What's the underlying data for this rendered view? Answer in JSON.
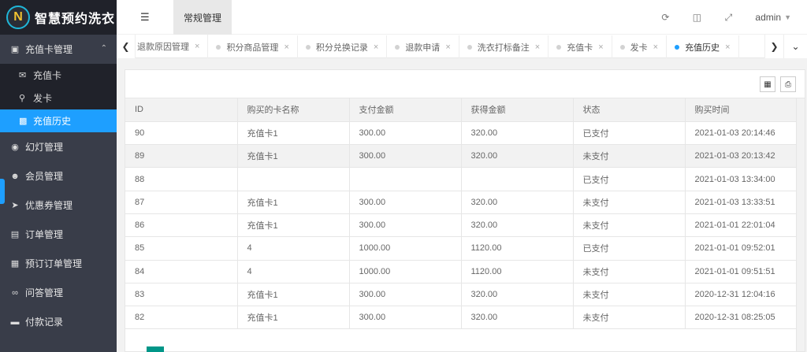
{
  "app": {
    "title": "智慧预约洗衣",
    "logo_letter": "N"
  },
  "sidebar": {
    "groups": [
      {
        "label": "充值卡管理",
        "icon": "gift-icon",
        "expanded": true,
        "items": [
          {
            "label": "充值卡",
            "icon": "envelope-icon"
          },
          {
            "label": "发卡",
            "icon": "tag-icon"
          },
          {
            "label": "充值历史",
            "icon": "briefcase-icon",
            "active": true
          }
        ]
      },
      {
        "label": "幻灯管理",
        "icon": "slides-icon"
      },
      {
        "label": "会员管理",
        "icon": "users-icon"
      },
      {
        "label": "优惠券管理",
        "icon": "rocket-icon"
      },
      {
        "label": "订单管理",
        "icon": "cart-icon"
      },
      {
        "label": "预订订单管理",
        "icon": "calendar-icon"
      },
      {
        "label": "问答管理",
        "icon": "glasses-icon"
      },
      {
        "label": "付款记录",
        "icon": "visa-icon"
      }
    ]
  },
  "header": {
    "active_module": "常规管理",
    "user": "admin"
  },
  "tabs": [
    {
      "label": "退款原因管理"
    },
    {
      "label": "积分商品管理"
    },
    {
      "label": "积分兑换记录"
    },
    {
      "label": "退款申请"
    },
    {
      "label": "洗衣打标备注"
    },
    {
      "label": "充值卡"
    },
    {
      "label": "发卡"
    },
    {
      "label": "充值历史",
      "active": true
    }
  ],
  "table": {
    "columns": [
      "ID",
      "购买的卡名称",
      "支付金额",
      "获得金额",
      "状态",
      "购买时间"
    ],
    "rows": [
      [
        "90",
        "充值卡1",
        "300.00",
        "320.00",
        "已支付",
        "2021-01-03 20:14:46"
      ],
      [
        "89",
        "充值卡1",
        "300.00",
        "320.00",
        "未支付",
        "2021-01-03 20:13:42"
      ],
      [
        "88",
        "",
        "",
        "",
        "已支付",
        "2021-01-03 13:34:00"
      ],
      [
        "87",
        "充值卡1",
        "300.00",
        "320.00",
        "未支付",
        "2021-01-03 13:33:51"
      ],
      [
        "86",
        "充值卡1",
        "300.00",
        "320.00",
        "未支付",
        "2021-01-01 22:01:04"
      ],
      [
        "85",
        "4",
        "1000.00",
        "1120.00",
        "已支付",
        "2021-01-01 09:52:01"
      ],
      [
        "84",
        "4",
        "1000.00",
        "1120.00",
        "未支付",
        "2021-01-01 09:51:51"
      ],
      [
        "83",
        "充值卡1",
        "300.00",
        "320.00",
        "未支付",
        "2020-12-31 12:04:16"
      ],
      [
        "82",
        "充值卡1",
        "300.00",
        "320.00",
        "未支付",
        "2020-12-31 08:25:05"
      ]
    ],
    "highlight_row": 1
  },
  "colors": {
    "sidebar": "#393d49",
    "accent": "#1e9fff",
    "logo_bg": "#20222a"
  }
}
